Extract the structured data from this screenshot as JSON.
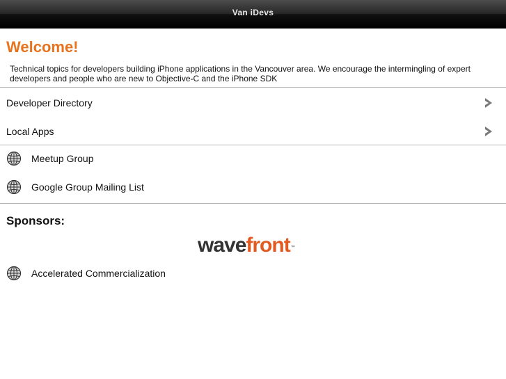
{
  "header": {
    "title": "Van iDevs"
  },
  "welcome": {
    "heading": "Welcome!",
    "intro": "Technical topics for developers building iPhone applications in the Vancouver area. We encourage the intermingling of expert developers and people who are new to Objective-C and the iPhone SDK"
  },
  "nav_items": [
    {
      "label": "Developer Directory",
      "icon": "chevron-right-icon"
    },
    {
      "label": "Local Apps",
      "icon": "chevron-right-icon"
    }
  ],
  "link_items": [
    {
      "label": "Meetup Group",
      "icon": "globe-icon"
    },
    {
      "label": "Google Group Mailing List",
      "icon": "globe-icon"
    }
  ],
  "sponsors": {
    "heading": "Sponsors:",
    "logo": {
      "part1": "wave",
      "part2": "front",
      "mark": "™"
    },
    "links": [
      {
        "label": "Accelerated Commercialization",
        "icon": "globe-icon"
      }
    ]
  },
  "colors": {
    "accent": "#e8731f",
    "logo_orange": "#e05a22",
    "divider": "#b3b3b3"
  }
}
